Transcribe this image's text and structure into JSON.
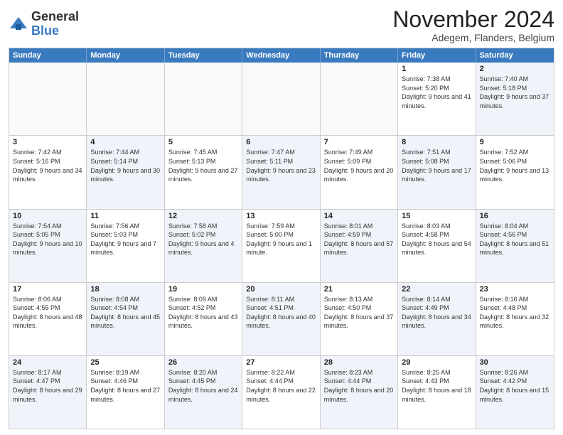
{
  "header": {
    "logo_general": "General",
    "logo_blue": "Blue",
    "month_title": "November 2024",
    "location": "Adegem, Flanders, Belgium"
  },
  "calendar": {
    "days_of_week": [
      "Sunday",
      "Monday",
      "Tuesday",
      "Wednesday",
      "Thursday",
      "Friday",
      "Saturday"
    ],
    "rows": [
      [
        {
          "day": "",
          "info": "",
          "empty": true
        },
        {
          "day": "",
          "info": "",
          "empty": true
        },
        {
          "day": "",
          "info": "",
          "empty": true
        },
        {
          "day": "",
          "info": "",
          "empty": true
        },
        {
          "day": "",
          "info": "",
          "empty": true
        },
        {
          "day": "1",
          "info": "Sunrise: 7:38 AM\nSunset: 5:20 PM\nDaylight: 9 hours and 41 minutes.",
          "alt": false
        },
        {
          "day": "2",
          "info": "Sunrise: 7:40 AM\nSunset: 5:18 PM\nDaylight: 9 hours and 37 minutes.",
          "alt": true
        }
      ],
      [
        {
          "day": "3",
          "info": "Sunrise: 7:42 AM\nSunset: 5:16 PM\nDaylight: 9 hours and 34 minutes.",
          "alt": false
        },
        {
          "day": "4",
          "info": "Sunrise: 7:44 AM\nSunset: 5:14 PM\nDaylight: 9 hours and 30 minutes.",
          "alt": true
        },
        {
          "day": "5",
          "info": "Sunrise: 7:45 AM\nSunset: 5:13 PM\nDaylight: 9 hours and 27 minutes.",
          "alt": false
        },
        {
          "day": "6",
          "info": "Sunrise: 7:47 AM\nSunset: 5:11 PM\nDaylight: 9 hours and 23 minutes.",
          "alt": true
        },
        {
          "day": "7",
          "info": "Sunrise: 7:49 AM\nSunset: 5:09 PM\nDaylight: 9 hours and 20 minutes.",
          "alt": false
        },
        {
          "day": "8",
          "info": "Sunrise: 7:51 AM\nSunset: 5:08 PM\nDaylight: 9 hours and 17 minutes.",
          "alt": true
        },
        {
          "day": "9",
          "info": "Sunrise: 7:52 AM\nSunset: 5:06 PM\nDaylight: 9 hours and 13 minutes.",
          "alt": false
        }
      ],
      [
        {
          "day": "10",
          "info": "Sunrise: 7:54 AM\nSunset: 5:05 PM\nDaylight: 9 hours and 10 minutes.",
          "alt": true
        },
        {
          "day": "11",
          "info": "Sunrise: 7:56 AM\nSunset: 5:03 PM\nDaylight: 9 hours and 7 minutes.",
          "alt": false
        },
        {
          "day": "12",
          "info": "Sunrise: 7:58 AM\nSunset: 5:02 PM\nDaylight: 9 hours and 4 minutes.",
          "alt": true
        },
        {
          "day": "13",
          "info": "Sunrise: 7:59 AM\nSunset: 5:00 PM\nDaylight: 9 hours and 1 minute.",
          "alt": false
        },
        {
          "day": "14",
          "info": "Sunrise: 8:01 AM\nSunset: 4:59 PM\nDaylight: 8 hours and 57 minutes.",
          "alt": true
        },
        {
          "day": "15",
          "info": "Sunrise: 8:03 AM\nSunset: 4:58 PM\nDaylight: 8 hours and 54 minutes.",
          "alt": false
        },
        {
          "day": "16",
          "info": "Sunrise: 8:04 AM\nSunset: 4:56 PM\nDaylight: 8 hours and 51 minutes.",
          "alt": true
        }
      ],
      [
        {
          "day": "17",
          "info": "Sunrise: 8:06 AM\nSunset: 4:55 PM\nDaylight: 8 hours and 48 minutes.",
          "alt": false
        },
        {
          "day": "18",
          "info": "Sunrise: 8:08 AM\nSunset: 4:54 PM\nDaylight: 8 hours and 45 minutes.",
          "alt": true
        },
        {
          "day": "19",
          "info": "Sunrise: 8:09 AM\nSunset: 4:52 PM\nDaylight: 8 hours and 43 minutes.",
          "alt": false
        },
        {
          "day": "20",
          "info": "Sunrise: 8:11 AM\nSunset: 4:51 PM\nDaylight: 8 hours and 40 minutes.",
          "alt": true
        },
        {
          "day": "21",
          "info": "Sunrise: 8:13 AM\nSunset: 4:50 PM\nDaylight: 8 hours and 37 minutes.",
          "alt": false
        },
        {
          "day": "22",
          "info": "Sunrise: 8:14 AM\nSunset: 4:49 PM\nDaylight: 8 hours and 34 minutes.",
          "alt": true
        },
        {
          "day": "23",
          "info": "Sunrise: 8:16 AM\nSunset: 4:48 PM\nDaylight: 8 hours and 32 minutes.",
          "alt": false
        }
      ],
      [
        {
          "day": "24",
          "info": "Sunrise: 8:17 AM\nSunset: 4:47 PM\nDaylight: 8 hours and 29 minutes.",
          "alt": true
        },
        {
          "day": "25",
          "info": "Sunrise: 8:19 AM\nSunset: 4:46 PM\nDaylight: 8 hours and 27 minutes.",
          "alt": false
        },
        {
          "day": "26",
          "info": "Sunrise: 8:20 AM\nSunset: 4:45 PM\nDaylight: 8 hours and 24 minutes.",
          "alt": true
        },
        {
          "day": "27",
          "info": "Sunrise: 8:22 AM\nSunset: 4:44 PM\nDaylight: 8 hours and 22 minutes.",
          "alt": false
        },
        {
          "day": "28",
          "info": "Sunrise: 8:23 AM\nSunset: 4:44 PM\nDaylight: 8 hours and 20 minutes.",
          "alt": true
        },
        {
          "day": "29",
          "info": "Sunrise: 8:25 AM\nSunset: 4:43 PM\nDaylight: 8 hours and 18 minutes.",
          "alt": false
        },
        {
          "day": "30",
          "info": "Sunrise: 8:26 AM\nSunset: 4:42 PM\nDaylight: 8 hours and 15 minutes.",
          "alt": true
        }
      ]
    ]
  }
}
